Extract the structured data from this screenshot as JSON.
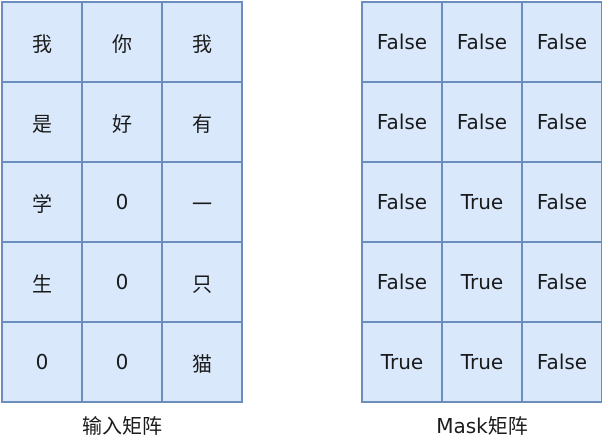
{
  "input_matrix": {
    "caption": "输入矩阵",
    "rows": [
      [
        "我",
        "你",
        "我"
      ],
      [
        "是",
        "好",
        "有"
      ],
      [
        "学",
        "0",
        "一"
      ],
      [
        "生",
        "0",
        "只"
      ],
      [
        "0",
        "0",
        "猫"
      ]
    ]
  },
  "mask_matrix": {
    "caption": "Mask矩阵",
    "rows": [
      [
        "False",
        "False",
        "False"
      ],
      [
        "False",
        "False",
        "False"
      ],
      [
        "False",
        "True",
        "False"
      ],
      [
        "False",
        "True",
        "False"
      ],
      [
        "True",
        "True",
        "False"
      ]
    ]
  },
  "colors": {
    "cell_fill": "#dae8fc",
    "cell_border": "#6c8ebf"
  }
}
